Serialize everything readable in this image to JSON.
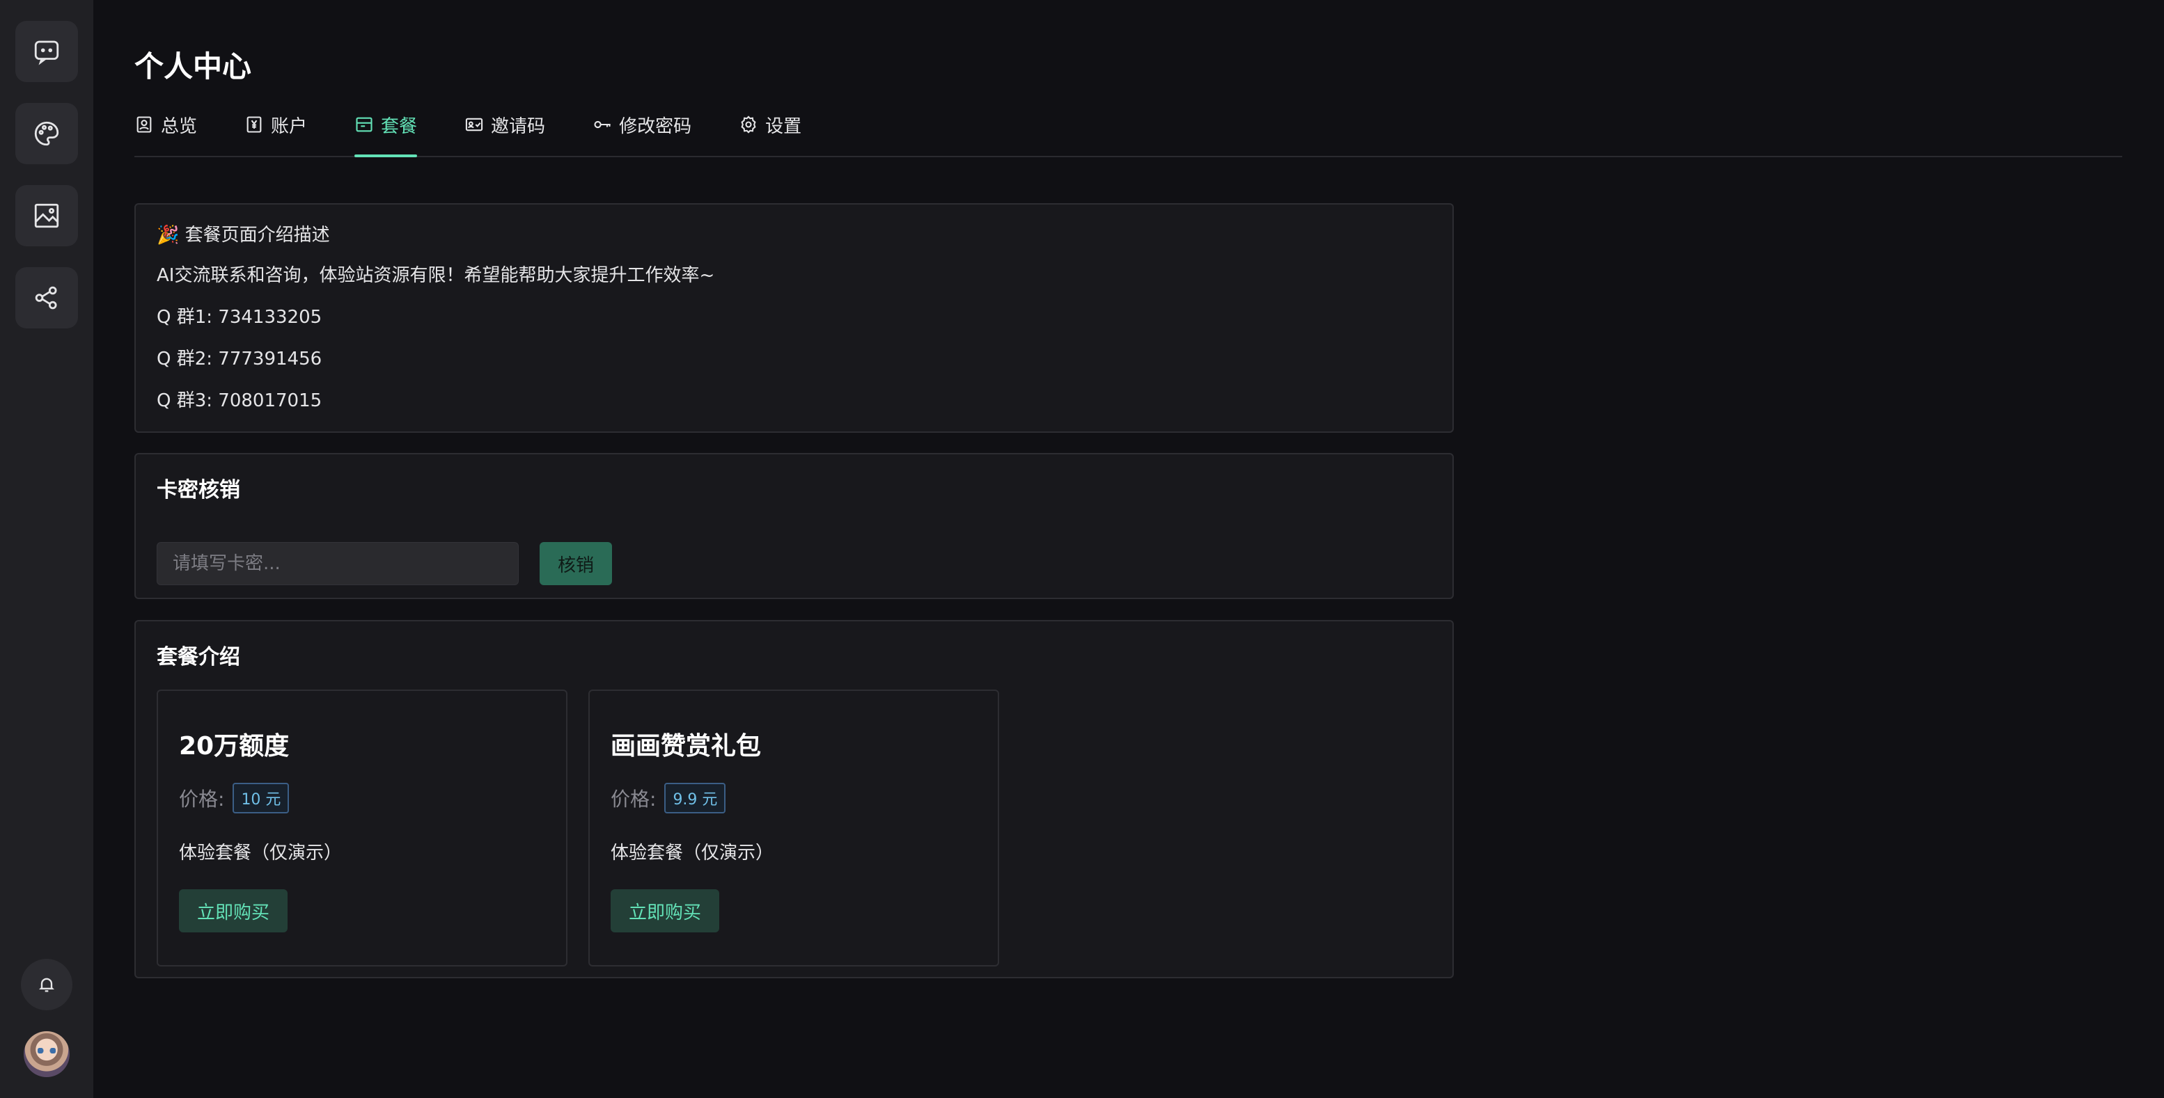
{
  "page": {
    "title": "个人中心"
  },
  "sidebar": {
    "items": [
      {
        "icon": "chat-bubble-icon"
      },
      {
        "icon": "palette-icon"
      },
      {
        "icon": "image-icon"
      },
      {
        "icon": "share-icon"
      }
    ],
    "bottom": {
      "bell_icon": "bell-icon",
      "avatar": "user-avatar"
    }
  },
  "tabs": [
    {
      "label": "总览",
      "icon": "user-square-icon",
      "active": false
    },
    {
      "label": "账户",
      "icon": "yen-square-icon",
      "active": false
    },
    {
      "label": "套餐",
      "icon": "package-icon",
      "active": true
    },
    {
      "label": "邀请码",
      "icon": "id-card-check-icon",
      "active": false
    },
    {
      "label": "修改密码",
      "icon": "key-icon",
      "active": false
    },
    {
      "label": "设置",
      "icon": "gear-icon",
      "active": false
    }
  ],
  "intro": {
    "lines": [
      "🎉 套餐页面介绍描述",
      "AI交流联系和咨询，体验站资源有限！希望能帮助大家提升工作效率~",
      "Q 群1: 734133205",
      "Q 群2: 777391456",
      "Q 群3: 708017015"
    ]
  },
  "redeem": {
    "title": "卡密核销",
    "placeholder": "请填写卡密...",
    "button_label": "核销"
  },
  "plans": {
    "title": "套餐介绍",
    "price_label": "价格:",
    "items": [
      {
        "name": "20万额度",
        "price": "10 元",
        "desc": "体验套餐（仅演示）",
        "button": "立即购买"
      },
      {
        "name": "画画赞赏礼包",
        "price": "9.9 元",
        "desc": "体验套餐（仅演示）",
        "button": "立即购买"
      }
    ]
  },
  "colors": {
    "accent": "#63e2b7",
    "background": "#101014",
    "card": "#18181c",
    "sidebar": "#202024",
    "price_tag": "#70c0e8"
  }
}
